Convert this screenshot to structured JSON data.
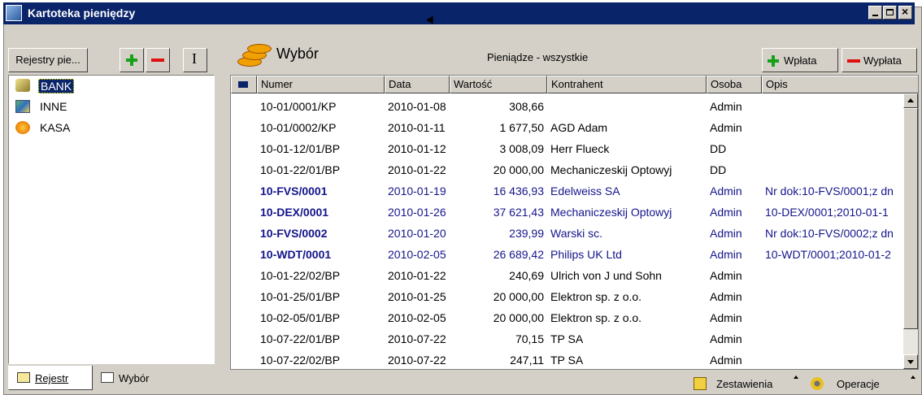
{
  "window": {
    "title": "Kartoteka pieniędzy"
  },
  "left": {
    "registers_button": "Rejestry pie...",
    "tree": [
      {
        "label": "BANK",
        "selected": true,
        "icon": "bank-icon"
      },
      {
        "label": "INNE",
        "selected": false,
        "icon": "other-icon"
      },
      {
        "label": "KASA",
        "selected": false,
        "icon": "cash-icon"
      }
    ],
    "tabs": [
      {
        "label": "Rejestr",
        "active": true
      },
      {
        "label": "Wybór",
        "active": false
      }
    ]
  },
  "right": {
    "title": "Wybór",
    "subtitle": "Pieniądze - wszystkie",
    "deposit_label": "Wpłata",
    "withdraw_label": "Wypłata",
    "columns": [
      "Numer",
      "Data",
      "Wartość",
      "Kontrahent",
      "Osoba",
      "Opis"
    ],
    "rows": [
      {
        "numer": "10-01/0001/KP",
        "data": "2010-01-08",
        "wartosc": "308,66",
        "kontrahent": "",
        "osoba": "Admin",
        "opis": "",
        "style": "normal"
      },
      {
        "numer": "10-01/0002/KP",
        "data": "2010-01-11",
        "wartosc": "1 677,50",
        "kontrahent": "AGD Adam",
        "osoba": "Admin",
        "opis": "",
        "style": "normal"
      },
      {
        "numer": "10-01-12/01/BP",
        "data": "2010-01-12",
        "wartosc": "3 008,09",
        "kontrahent": "Herr Flueck",
        "osoba": "DD",
        "opis": "",
        "style": "normal"
      },
      {
        "numer": "10-01-22/01/BP",
        "data": "2010-01-22",
        "wartosc": "20 000,00",
        "kontrahent": "Mechaniczeskij Optowyj",
        "osoba": "DD",
        "opis": "",
        "style": "normal"
      },
      {
        "numer": "10-FVS/0001",
        "data": "2010-01-19",
        "wartosc": "16 436,93",
        "kontrahent": "Edelweiss SA",
        "osoba": "Admin",
        "opis": "Nr dok:10-FVS/0001;z dn",
        "style": "blue"
      },
      {
        "numer": "10-DEX/0001",
        "data": "2010-01-26",
        "wartosc": "37 621,43",
        "kontrahent": "Mechaniczeskij Optowyj",
        "osoba": "Admin",
        "opis": "10-DEX/0001;2010-01-1",
        "style": "blue"
      },
      {
        "numer": "10-FVS/0002",
        "data": "2010-01-20",
        "wartosc": "239,99",
        "kontrahent": "Warski sc.",
        "osoba": "Admin",
        "opis": "Nr dok:10-FVS/0002;z dn",
        "style": "blue"
      },
      {
        "numer": "10-WDT/0001",
        "data": "2010-02-05",
        "wartosc": "26 689,42",
        "kontrahent": "Philips UK Ltd",
        "osoba": "Admin",
        "opis": "10-WDT/0001;2010-01-2",
        "style": "blue"
      },
      {
        "numer": "10-01-22/02/BP",
        "data": "2010-01-22",
        "wartosc": "240,69",
        "kontrahent": "Ulrich von J und Sohn",
        "osoba": "Admin",
        "opis": "",
        "style": "normal"
      },
      {
        "numer": "10-01-25/01/BP",
        "data": "2010-01-25",
        "wartosc": "20 000,00",
        "kontrahent": "Elektron sp. z o.o.",
        "osoba": "Admin",
        "opis": "",
        "style": "normal"
      },
      {
        "numer": "10-02-05/01/BP",
        "data": "2010-02-05",
        "wartosc": "20 000,00",
        "kontrahent": "Elektron sp. z o.o.",
        "osoba": "Admin",
        "opis": "",
        "style": "normal"
      },
      {
        "numer": "10-07-22/01/BP",
        "data": "2010-07-22",
        "wartosc": "70,15",
        "kontrahent": "TP SA",
        "osoba": "Admin",
        "opis": "",
        "style": "normal"
      },
      {
        "numer": "10-07-22/02/BP",
        "data": "2010-07-22",
        "wartosc": "247,11",
        "kontrahent": "TP SA",
        "osoba": "Admin",
        "opis": "",
        "style": "normal"
      }
    ],
    "status": {
      "reports_label": "Zestawienia",
      "operations_label": "Operacje"
    }
  },
  "colors": {
    "title_bar": "#0a246a",
    "link_blue": "#14148c",
    "face": "#d4d0c8"
  }
}
